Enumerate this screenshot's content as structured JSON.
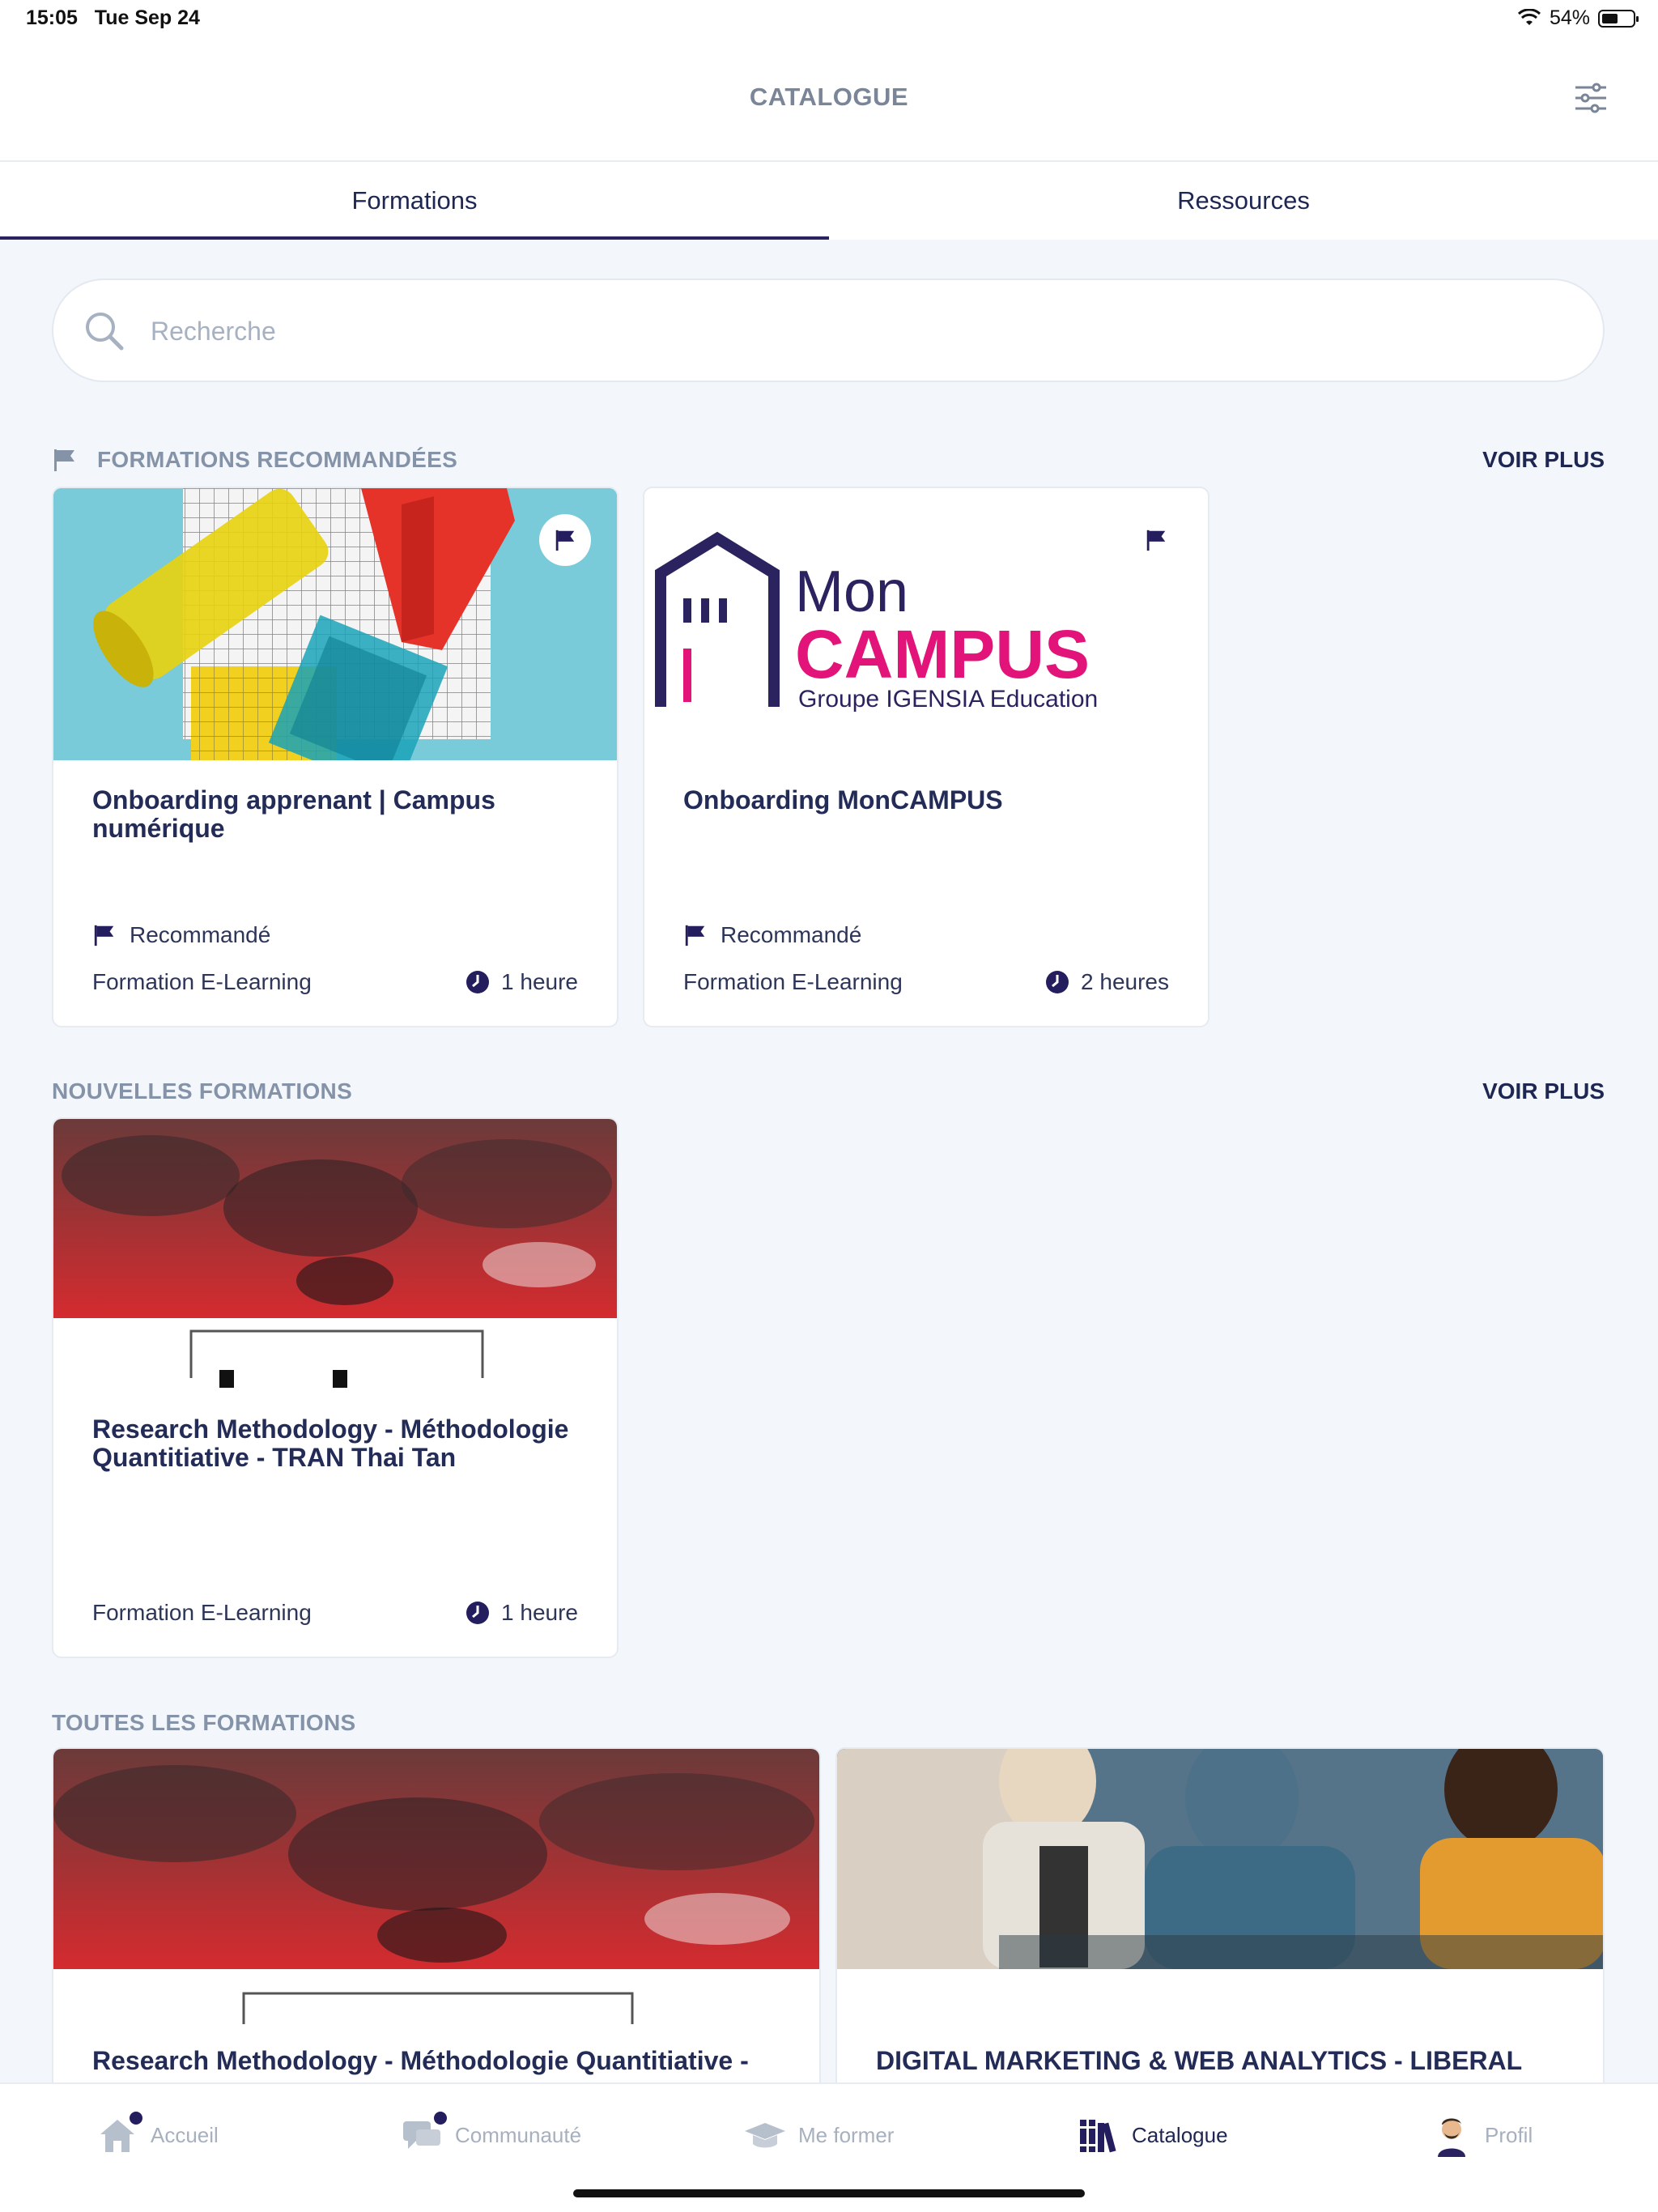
{
  "status_bar": {
    "time": "15:05",
    "date": "Tue Sep 24",
    "battery": "54%",
    "battery_level": 0.54
  },
  "header": {
    "title": "CATALOGUE",
    "filter_icon": "sliders-icon"
  },
  "tabs": [
    {
      "label": "Formations",
      "active": true
    },
    {
      "label": "Ressources",
      "active": false
    }
  ],
  "search": {
    "placeholder": "Recherche",
    "value": ""
  },
  "recommended": {
    "title": "FORMATIONS RECOMMANDÉES",
    "more": "VOIR PLUS",
    "cards": [
      {
        "title": "Onboarding apprenant | Campus numérique",
        "badge": "Recommandé",
        "type": "Formation E-Learning",
        "duration": "1 heure"
      },
      {
        "title": "Onboarding MonCAMPUS",
        "badge": "Recommandé",
        "type": "Formation E-Learning",
        "duration": "2 heures",
        "logo": {
          "line1": "Mon",
          "line2": "CAMPUS",
          "line3": "Groupe IGENSIA Education"
        }
      }
    ]
  },
  "new": {
    "title": "NOUVELLES FORMATIONS",
    "more": "VOIR PLUS",
    "cards": [
      {
        "title": "Research Methodology - Méthodologie Quantitiative - TRAN Thai Tan",
        "type": "Formation E-Learning",
        "duration": "1 heure"
      }
    ]
  },
  "all": {
    "title": "TOUTES LES FORMATIONS",
    "cards": [
      {
        "title": "Research Methodology - Méthodologie Quantitiative - TRAN Thai Tan"
      },
      {
        "title": "DIGITAL MARKETING & WEB ANALYTICS - LIBERAL Cert"
      }
    ]
  },
  "tabbar": [
    {
      "label": "Accueil",
      "icon": "home-icon",
      "active": false,
      "dot": true
    },
    {
      "label": "Communauté",
      "icon": "chat-icon",
      "active": false,
      "dot": true
    },
    {
      "label": "Me former",
      "icon": "graduation-cap-icon",
      "active": false,
      "dot": false
    },
    {
      "label": "Catalogue",
      "icon": "books-icon",
      "active": true,
      "dot": false
    },
    {
      "label": "Profil",
      "icon": "avatar-icon",
      "active": false,
      "dot": false
    }
  ],
  "colors": {
    "accent": "#2b235f",
    "brand_pink": "#e2147a",
    "muted": "#8593a8",
    "background": "#f3f6fb"
  }
}
